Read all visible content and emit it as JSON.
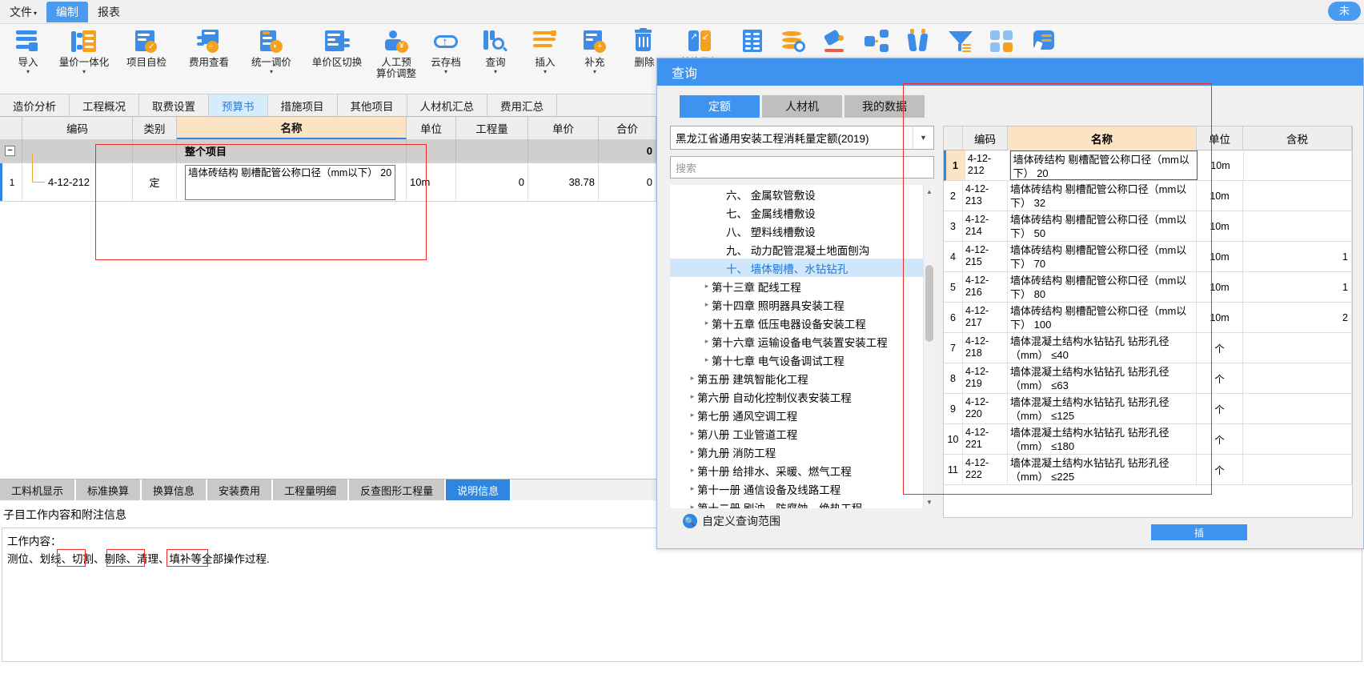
{
  "menubar": {
    "items": [
      {
        "label": "文件",
        "caret": true,
        "active": false
      },
      {
        "label": "编制",
        "caret": false,
        "active": true
      },
      {
        "label": "报表",
        "caret": false,
        "active": false
      }
    ],
    "right_badge": "未"
  },
  "ribbon": {
    "buttons": [
      {
        "name": "import",
        "label": "导入",
        "label2": "",
        "dropdown": true,
        "icon": "import-icon"
      },
      {
        "name": "quantity-price-integration",
        "label": "量价一体化",
        "label2": "",
        "dropdown": true,
        "icon": "integration-icon"
      },
      {
        "name": "project-self-check",
        "label": "项目自检",
        "label2": "",
        "dropdown": false,
        "icon": "check-icon"
      },
      {
        "name": "fee-view",
        "label": "费用查看",
        "label2": "",
        "dropdown": false,
        "icon": "fee-icon"
      },
      {
        "name": "unified-price-adjust",
        "label": "统一调价",
        "label2": "",
        "dropdown": true,
        "icon": "adjust-icon"
      },
      {
        "name": "unit-price-zone-switch",
        "label": "单价区切换",
        "label2": "",
        "dropdown": false,
        "icon": "switch-icon"
      },
      {
        "name": "labor-budget-price-adjust",
        "label": "人工预",
        "label2": "算价调整",
        "dropdown": false,
        "icon": "person-icon"
      },
      {
        "name": "cloud-archive",
        "label": "云存档",
        "label2": "",
        "dropdown": true,
        "icon": "cloud-upload-icon"
      },
      {
        "name": "query",
        "label": "查询",
        "label2": "",
        "dropdown": true,
        "icon": "search-book-icon"
      },
      {
        "name": "insert",
        "label": "插入",
        "label2": "",
        "dropdown": true,
        "icon": "insert-icon"
      },
      {
        "name": "supplement",
        "label": "补充",
        "label2": "",
        "dropdown": true,
        "icon": "add-doc-icon"
      },
      {
        "name": "delete",
        "label": "删除",
        "label2": "",
        "dropdown": false,
        "icon": "trash-icon"
      },
      {
        "name": "replace-data",
        "label": "替换数据",
        "label2": "",
        "dropdown": false,
        "icon": "replace-icon"
      },
      {
        "name": "batch",
        "label": "",
        "label2": "",
        "dropdown": false,
        "icon": "table-icon"
      },
      {
        "name": "coin-query",
        "label": "",
        "label2": "",
        "dropdown": false,
        "icon": "coins-icon"
      },
      {
        "name": "paint",
        "label": "",
        "label2": "",
        "dropdown": false,
        "icon": "paint-icon"
      },
      {
        "name": "structure",
        "label": "",
        "label2": "",
        "dropdown": false,
        "icon": "nodes-icon"
      },
      {
        "name": "compare",
        "label": "",
        "label2": "",
        "dropdown": false,
        "icon": "binocular-icon"
      },
      {
        "name": "filter",
        "label": "",
        "label2": "",
        "dropdown": false,
        "icon": "filter-icon"
      },
      {
        "name": "grid-view",
        "label": "",
        "label2": "",
        "dropdown": false,
        "icon": "grid-icon"
      },
      {
        "name": "note",
        "label": "",
        "label2": "",
        "dropdown": false,
        "icon": "note-pen-icon"
      }
    ]
  },
  "tabs": {
    "items": [
      {
        "label": "造价分析",
        "active": false
      },
      {
        "label": "工程概况",
        "active": false
      },
      {
        "label": "取费设置",
        "active": false
      },
      {
        "label": "预算书",
        "active": true
      },
      {
        "label": "措施项目",
        "active": false
      },
      {
        "label": "其他项目",
        "active": false
      },
      {
        "label": "人材机汇总",
        "active": false
      },
      {
        "label": "费用汇总",
        "active": false
      }
    ]
  },
  "grid": {
    "columns": [
      "编码",
      "类别",
      "名称",
      "单位",
      "工程量",
      "单价",
      "合价"
    ],
    "rows": [
      {
        "index": "",
        "is_group": true,
        "expander": "−",
        "code": "",
        "category": "",
        "name": "整个项目",
        "unit": "",
        "quantity": "",
        "unit_price": "",
        "total_price": "0"
      },
      {
        "index": "1",
        "is_group": false,
        "expander": "",
        "code": "4-12-212",
        "category": "定",
        "name": "墙体砖结构 剔槽配管公称口径（mm以下） 20",
        "unit": "10m",
        "quantity": "0",
        "unit_price": "38.78",
        "total_price": "0"
      }
    ]
  },
  "bottom": {
    "tabs": [
      {
        "label": "工料机显示",
        "active": false
      },
      {
        "label": "标准换算",
        "active": false
      },
      {
        "label": "换算信息",
        "active": false
      },
      {
        "label": "安装费用",
        "active": false
      },
      {
        "label": "工程量明细",
        "active": false
      },
      {
        "label": "反查图形工程量",
        "active": false
      },
      {
        "label": "说明信息",
        "active": true
      }
    ],
    "section_title": "子目工作内容和附注信息",
    "content_label": "工作内容：",
    "content_text": "测位、划线、切割、剔除、清理、填补等全部操作过程."
  },
  "dialog": {
    "title": "查询",
    "tabs": [
      {
        "label": "定额",
        "active": true
      },
      {
        "label": "人材机",
        "active": false
      },
      {
        "label": "我的数据",
        "active": false
      }
    ],
    "standard_select": "黑龙江省通用安装工程消耗量定额(2019)",
    "search_placeholder": "搜索",
    "custom_range_label": "自定义查询范围",
    "insert_button": "插",
    "bottom_button": "插",
    "tree": [
      {
        "label": "六、 金属软管敷设",
        "indent": 3,
        "arrow": "",
        "selected": false
      },
      {
        "label": "七、 金属线槽敷设",
        "indent": 3,
        "arrow": "",
        "selected": false
      },
      {
        "label": "八、 塑料线槽敷设",
        "indent": 3,
        "arrow": "",
        "selected": false
      },
      {
        "label": "九、 动力配管混凝土地面刨沟",
        "indent": 3,
        "arrow": "",
        "selected": false
      },
      {
        "label": "十、 墙体剔槽、水钻钻孔",
        "indent": 3,
        "arrow": "",
        "selected": true
      },
      {
        "label": "第十三章 配线工程",
        "indent": 2,
        "arrow": "▸",
        "selected": false
      },
      {
        "label": "第十四章 照明器具安装工程",
        "indent": 2,
        "arrow": "▸",
        "selected": false
      },
      {
        "label": "第十五章 低压电器设备安装工程",
        "indent": 2,
        "arrow": "▸",
        "selected": false
      },
      {
        "label": "第十六章 运输设备电气装置安装工程",
        "indent": 2,
        "arrow": "▸",
        "selected": false
      },
      {
        "label": "第十七章 电气设备调试工程",
        "indent": 2,
        "arrow": "▸",
        "selected": false
      },
      {
        "label": "第五册 建筑智能化工程",
        "indent": 1,
        "arrow": "▸",
        "selected": false
      },
      {
        "label": "第六册 自动化控制仪表安装工程",
        "indent": 1,
        "arrow": "▸",
        "selected": false
      },
      {
        "label": "第七册 通风空调工程",
        "indent": 1,
        "arrow": "▸",
        "selected": false
      },
      {
        "label": "第八册 工业管道工程",
        "indent": 1,
        "arrow": "▸",
        "selected": false
      },
      {
        "label": "第九册 消防工程",
        "indent": 1,
        "arrow": "▸",
        "selected": false
      },
      {
        "label": "第十册 给排水、采暖、燃气工程",
        "indent": 1,
        "arrow": "▸",
        "selected": false
      },
      {
        "label": "第十一册 通信设备及线路工程",
        "indent": 1,
        "arrow": "▸",
        "selected": false
      },
      {
        "label": "第十二册 刷油、防腐蚀、绝热工程",
        "indent": 1,
        "arrow": "▸",
        "selected": false
      }
    ],
    "results": {
      "columns": [
        "编码",
        "名称",
        "单位",
        "含税"
      ],
      "rows": [
        {
          "idx": "1",
          "code": "4-12-212",
          "name": "墙体砖结构 剔槽配管公称口径（mm以下） 20",
          "unit": "10m",
          "tax": "",
          "selected": true
        },
        {
          "idx": "2",
          "code": "4-12-213",
          "name": "墙体砖结构 剔槽配管公称口径（mm以下） 32",
          "unit": "10m",
          "tax": "",
          "selected": false
        },
        {
          "idx": "3",
          "code": "4-12-214",
          "name": "墙体砖结构 剔槽配管公称口径（mm以下） 50",
          "unit": "10m",
          "tax": "",
          "selected": false
        },
        {
          "idx": "4",
          "code": "4-12-215",
          "name": "墙体砖结构 剔槽配管公称口径（mm以下） 70",
          "unit": "10m",
          "tax": "1",
          "selected": false
        },
        {
          "idx": "5",
          "code": "4-12-216",
          "name": "墙体砖结构 剔槽配管公称口径（mm以下） 80",
          "unit": "10m",
          "tax": "1",
          "selected": false
        },
        {
          "idx": "6",
          "code": "4-12-217",
          "name": "墙体砖结构 剔槽配管公称口径（mm以下） 100",
          "unit": "10m",
          "tax": "2",
          "selected": false
        },
        {
          "idx": "7",
          "code": "4-12-218",
          "name": "墙体混凝土结构水钻钻孔 钻形孔径（mm） ≤40",
          "unit": "个",
          "tax": "",
          "selected": false
        },
        {
          "idx": "8",
          "code": "4-12-219",
          "name": "墙体混凝土结构水钻钻孔 钻形孔径（mm） ≤63",
          "unit": "个",
          "tax": "",
          "selected": false
        },
        {
          "idx": "9",
          "code": "4-12-220",
          "name": "墙体混凝土结构水钻钻孔 钻形孔径（mm） ≤125",
          "unit": "个",
          "tax": "",
          "selected": false
        },
        {
          "idx": "10",
          "code": "4-12-221",
          "name": "墙体混凝土结构水钻钻孔 钻形孔径（mm） ≤180",
          "unit": "个",
          "tax": "",
          "selected": false
        },
        {
          "idx": "11",
          "code": "4-12-222",
          "name": "墙体混凝土结构水钻钻孔 钻形孔径（mm） ≤225",
          "unit": "个",
          "tax": "",
          "selected": false
        }
      ]
    }
  },
  "colors": {
    "accent": "#3d93ef",
    "orange": "#f5a01e",
    "annotation": "#ee2b2b",
    "name_header": "#fce3c4"
  }
}
